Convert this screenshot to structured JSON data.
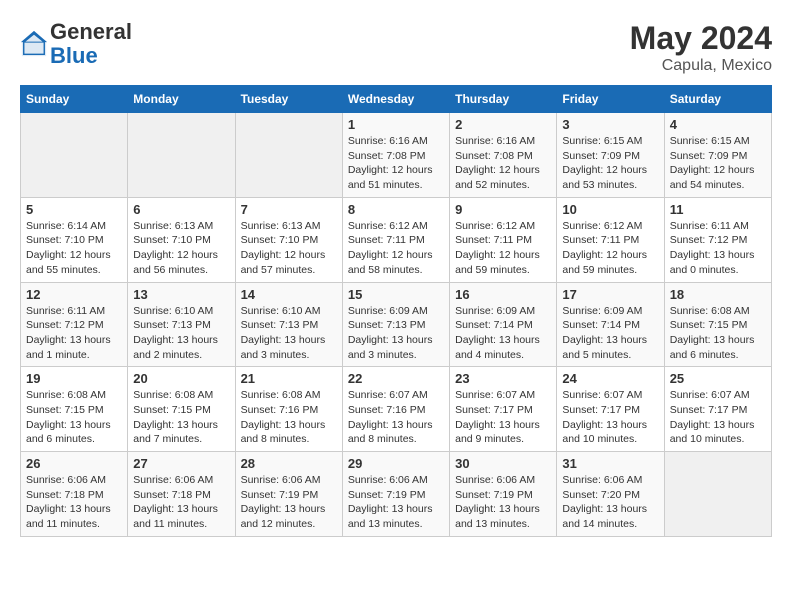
{
  "header": {
    "logo_general": "General",
    "logo_blue": "Blue",
    "month_year": "May 2024",
    "location": "Capula, Mexico"
  },
  "days_of_week": [
    "Sunday",
    "Monday",
    "Tuesday",
    "Wednesday",
    "Thursday",
    "Friday",
    "Saturday"
  ],
  "weeks": [
    [
      {
        "day": "",
        "info": ""
      },
      {
        "day": "",
        "info": ""
      },
      {
        "day": "",
        "info": ""
      },
      {
        "day": "1",
        "info": "Sunrise: 6:16 AM\nSunset: 7:08 PM\nDaylight: 12 hours\nand 51 minutes."
      },
      {
        "day": "2",
        "info": "Sunrise: 6:16 AM\nSunset: 7:08 PM\nDaylight: 12 hours\nand 52 minutes."
      },
      {
        "day": "3",
        "info": "Sunrise: 6:15 AM\nSunset: 7:09 PM\nDaylight: 12 hours\nand 53 minutes."
      },
      {
        "day": "4",
        "info": "Sunrise: 6:15 AM\nSunset: 7:09 PM\nDaylight: 12 hours\nand 54 minutes."
      }
    ],
    [
      {
        "day": "5",
        "info": "Sunrise: 6:14 AM\nSunset: 7:10 PM\nDaylight: 12 hours\nand 55 minutes."
      },
      {
        "day": "6",
        "info": "Sunrise: 6:13 AM\nSunset: 7:10 PM\nDaylight: 12 hours\nand 56 minutes."
      },
      {
        "day": "7",
        "info": "Sunrise: 6:13 AM\nSunset: 7:10 PM\nDaylight: 12 hours\nand 57 minutes."
      },
      {
        "day": "8",
        "info": "Sunrise: 6:12 AM\nSunset: 7:11 PM\nDaylight: 12 hours\nand 58 minutes."
      },
      {
        "day": "9",
        "info": "Sunrise: 6:12 AM\nSunset: 7:11 PM\nDaylight: 12 hours\nand 59 minutes."
      },
      {
        "day": "10",
        "info": "Sunrise: 6:12 AM\nSunset: 7:11 PM\nDaylight: 12 hours\nand 59 minutes."
      },
      {
        "day": "11",
        "info": "Sunrise: 6:11 AM\nSunset: 7:12 PM\nDaylight: 13 hours\nand 0 minutes."
      }
    ],
    [
      {
        "day": "12",
        "info": "Sunrise: 6:11 AM\nSunset: 7:12 PM\nDaylight: 13 hours\nand 1 minute."
      },
      {
        "day": "13",
        "info": "Sunrise: 6:10 AM\nSunset: 7:13 PM\nDaylight: 13 hours\nand 2 minutes."
      },
      {
        "day": "14",
        "info": "Sunrise: 6:10 AM\nSunset: 7:13 PM\nDaylight: 13 hours\nand 3 minutes."
      },
      {
        "day": "15",
        "info": "Sunrise: 6:09 AM\nSunset: 7:13 PM\nDaylight: 13 hours\nand 3 minutes."
      },
      {
        "day": "16",
        "info": "Sunrise: 6:09 AM\nSunset: 7:14 PM\nDaylight: 13 hours\nand 4 minutes."
      },
      {
        "day": "17",
        "info": "Sunrise: 6:09 AM\nSunset: 7:14 PM\nDaylight: 13 hours\nand 5 minutes."
      },
      {
        "day": "18",
        "info": "Sunrise: 6:08 AM\nSunset: 7:15 PM\nDaylight: 13 hours\nand 6 minutes."
      }
    ],
    [
      {
        "day": "19",
        "info": "Sunrise: 6:08 AM\nSunset: 7:15 PM\nDaylight: 13 hours\nand 6 minutes."
      },
      {
        "day": "20",
        "info": "Sunrise: 6:08 AM\nSunset: 7:15 PM\nDaylight: 13 hours\nand 7 minutes."
      },
      {
        "day": "21",
        "info": "Sunrise: 6:08 AM\nSunset: 7:16 PM\nDaylight: 13 hours\nand 8 minutes."
      },
      {
        "day": "22",
        "info": "Sunrise: 6:07 AM\nSunset: 7:16 PM\nDaylight: 13 hours\nand 8 minutes."
      },
      {
        "day": "23",
        "info": "Sunrise: 6:07 AM\nSunset: 7:17 PM\nDaylight: 13 hours\nand 9 minutes."
      },
      {
        "day": "24",
        "info": "Sunrise: 6:07 AM\nSunset: 7:17 PM\nDaylight: 13 hours\nand 10 minutes."
      },
      {
        "day": "25",
        "info": "Sunrise: 6:07 AM\nSunset: 7:17 PM\nDaylight: 13 hours\nand 10 minutes."
      }
    ],
    [
      {
        "day": "26",
        "info": "Sunrise: 6:06 AM\nSunset: 7:18 PM\nDaylight: 13 hours\nand 11 minutes."
      },
      {
        "day": "27",
        "info": "Sunrise: 6:06 AM\nSunset: 7:18 PM\nDaylight: 13 hours\nand 11 minutes."
      },
      {
        "day": "28",
        "info": "Sunrise: 6:06 AM\nSunset: 7:19 PM\nDaylight: 13 hours\nand 12 minutes."
      },
      {
        "day": "29",
        "info": "Sunrise: 6:06 AM\nSunset: 7:19 PM\nDaylight: 13 hours\nand 13 minutes."
      },
      {
        "day": "30",
        "info": "Sunrise: 6:06 AM\nSunset: 7:19 PM\nDaylight: 13 hours\nand 13 minutes."
      },
      {
        "day": "31",
        "info": "Sunrise: 6:06 AM\nSunset: 7:20 PM\nDaylight: 13 hours\nand 14 minutes."
      },
      {
        "day": "",
        "info": ""
      }
    ]
  ]
}
